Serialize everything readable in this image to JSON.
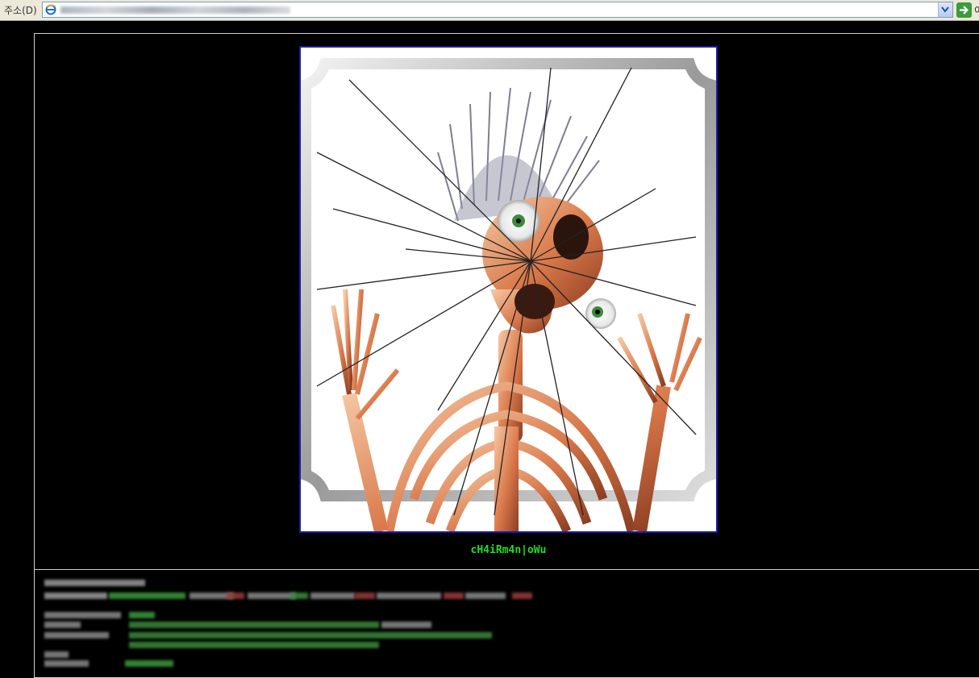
{
  "browser": {
    "address_label": "주소(D)",
    "go_label": "이"
  },
  "page": {
    "image": "broken-mirror-skeleton",
    "caption": "cH4iRm4n|oWu"
  },
  "colors": {
    "background": "#000000",
    "caption": "#22dd22",
    "picture_border": "#1a1ab0",
    "frame_line": "#d0d0d0"
  }
}
